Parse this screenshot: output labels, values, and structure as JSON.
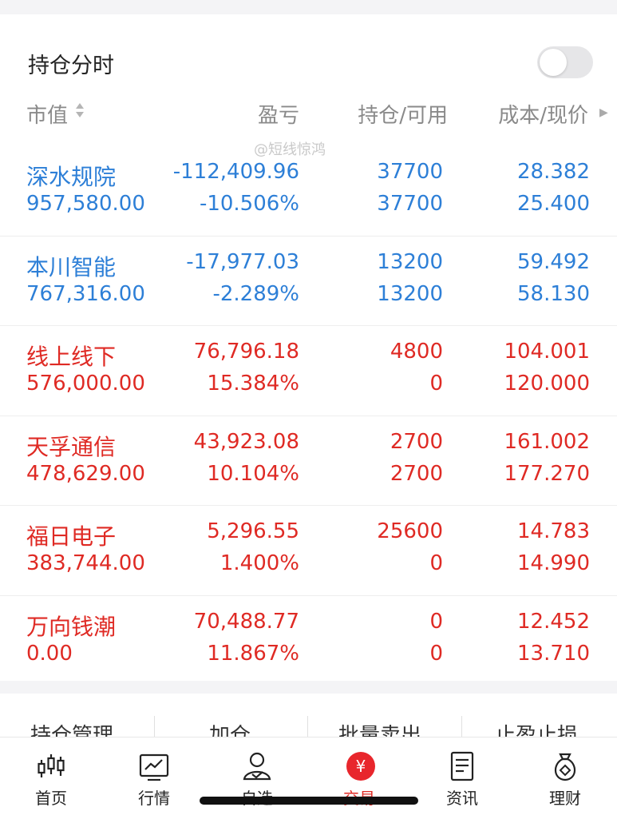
{
  "header": {
    "title": "持仓分时",
    "toggle_on": false
  },
  "columns": {
    "market_value": "市值",
    "profit_loss": "盈亏",
    "position": "持仓/可用",
    "cost_price": "成本/现价"
  },
  "watermark": "@短线惊鸿",
  "holdings": [
    {
      "name": "深水规院",
      "market_value": "957,580.00",
      "profit_loss": "-112,409.96",
      "profit_pct": "-10.506%",
      "position": "37700",
      "available": "37700",
      "cost": "28.382",
      "price": "25.400",
      "color": "blue"
    },
    {
      "name": "本川智能",
      "market_value": "767,316.00",
      "profit_loss": "-17,977.03",
      "profit_pct": "-2.289%",
      "position": "13200",
      "available": "13200",
      "cost": "59.492",
      "price": "58.130",
      "color": "blue"
    },
    {
      "name": "线上线下",
      "market_value": "576,000.00",
      "profit_loss": "76,796.18",
      "profit_pct": "15.384%",
      "position": "4800",
      "available": "0",
      "cost": "104.001",
      "price": "120.000",
      "color": "red"
    },
    {
      "name": "天孚通信",
      "market_value": "478,629.00",
      "profit_loss": "43,923.08",
      "profit_pct": "10.104%",
      "position": "2700",
      "available": "2700",
      "cost": "161.002",
      "price": "177.270",
      "color": "red"
    },
    {
      "name": "福日电子",
      "market_value": "383,744.00",
      "profit_loss": "5,296.55",
      "profit_pct": "1.400%",
      "position": "25600",
      "available": "0",
      "cost": "14.783",
      "price": "14.990",
      "color": "red"
    },
    {
      "name": "万向钱潮",
      "market_value": "0.00",
      "profit_loss": "70,488.77",
      "profit_pct": "11.867%",
      "position": "0",
      "available": "0",
      "cost": "12.452",
      "price": "13.710",
      "color": "red"
    }
  ],
  "actions": [
    "持仓管理",
    "加仓",
    "批量卖出",
    "止盈止损"
  ],
  "tabs": [
    {
      "label": "首页",
      "icon": "candlestick-icon"
    },
    {
      "label": "行情",
      "icon": "chart-icon"
    },
    {
      "label": "自选",
      "icon": "person-check-icon"
    },
    {
      "label": "交易",
      "icon": "yen-icon",
      "active": true
    },
    {
      "label": "资讯",
      "icon": "document-icon"
    },
    {
      "label": "理财",
      "icon": "money-bag-icon"
    }
  ],
  "colors": {
    "red": "#df2a24",
    "blue": "#2d7fd7",
    "accent": "#e8262c"
  }
}
